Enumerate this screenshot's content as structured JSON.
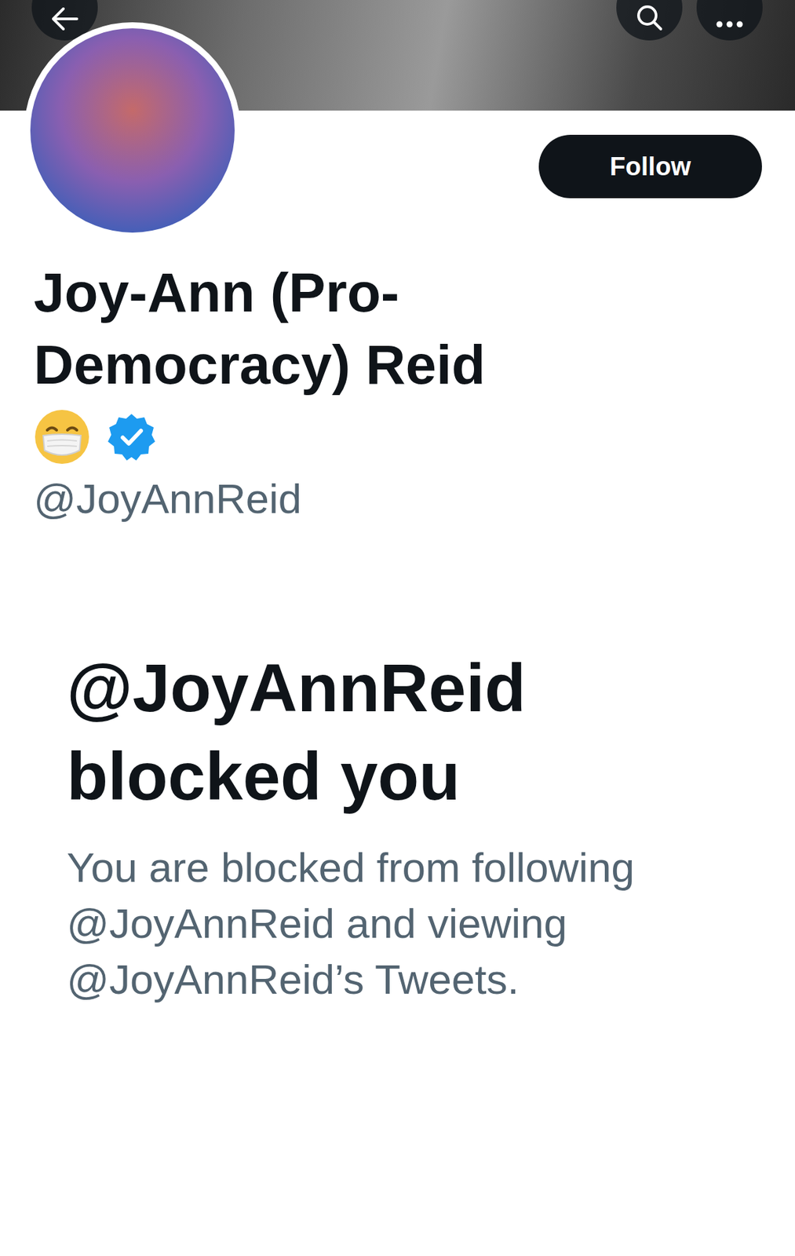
{
  "profile": {
    "name": "Joy-Ann (Pro-Democracy) Reid",
    "handle": "@JoyAnnReid",
    "verified": true
  },
  "follow_button": "Follow",
  "blocked": {
    "title": "@JoyAnnReid blocked you",
    "message": "You are blocked from following @JoyAnnReid and viewing @JoyAnnReid’s Tweets."
  }
}
